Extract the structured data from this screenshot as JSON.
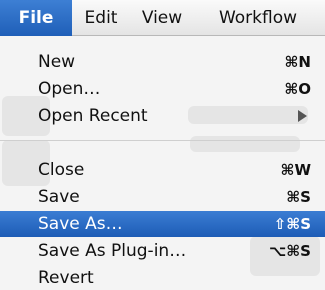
{
  "menubar": {
    "items": [
      {
        "label": "File"
      },
      {
        "label": "Edit"
      },
      {
        "label": "View"
      },
      {
        "label": "Workflow"
      }
    ]
  },
  "file_menu": {
    "items": [
      {
        "label": "New",
        "shortcut": "⌘N"
      },
      {
        "label": "Open…",
        "shortcut": "⌘O"
      },
      {
        "label": "Open Recent",
        "shortcut": ""
      },
      {
        "label": "Close",
        "shortcut": "⌘W"
      },
      {
        "label": "Save",
        "shortcut": "⌘S"
      },
      {
        "label": "Save As…",
        "shortcut": "⇧⌘S"
      },
      {
        "label": "Save As Plug-in…",
        "shortcut": "⌥⌘S"
      },
      {
        "label": "Revert",
        "shortcut": ""
      }
    ]
  },
  "colors": {
    "menubar_bg": "#ededed",
    "selection": "#2a6cc6",
    "menu_bg": "#f4f4f4"
  }
}
